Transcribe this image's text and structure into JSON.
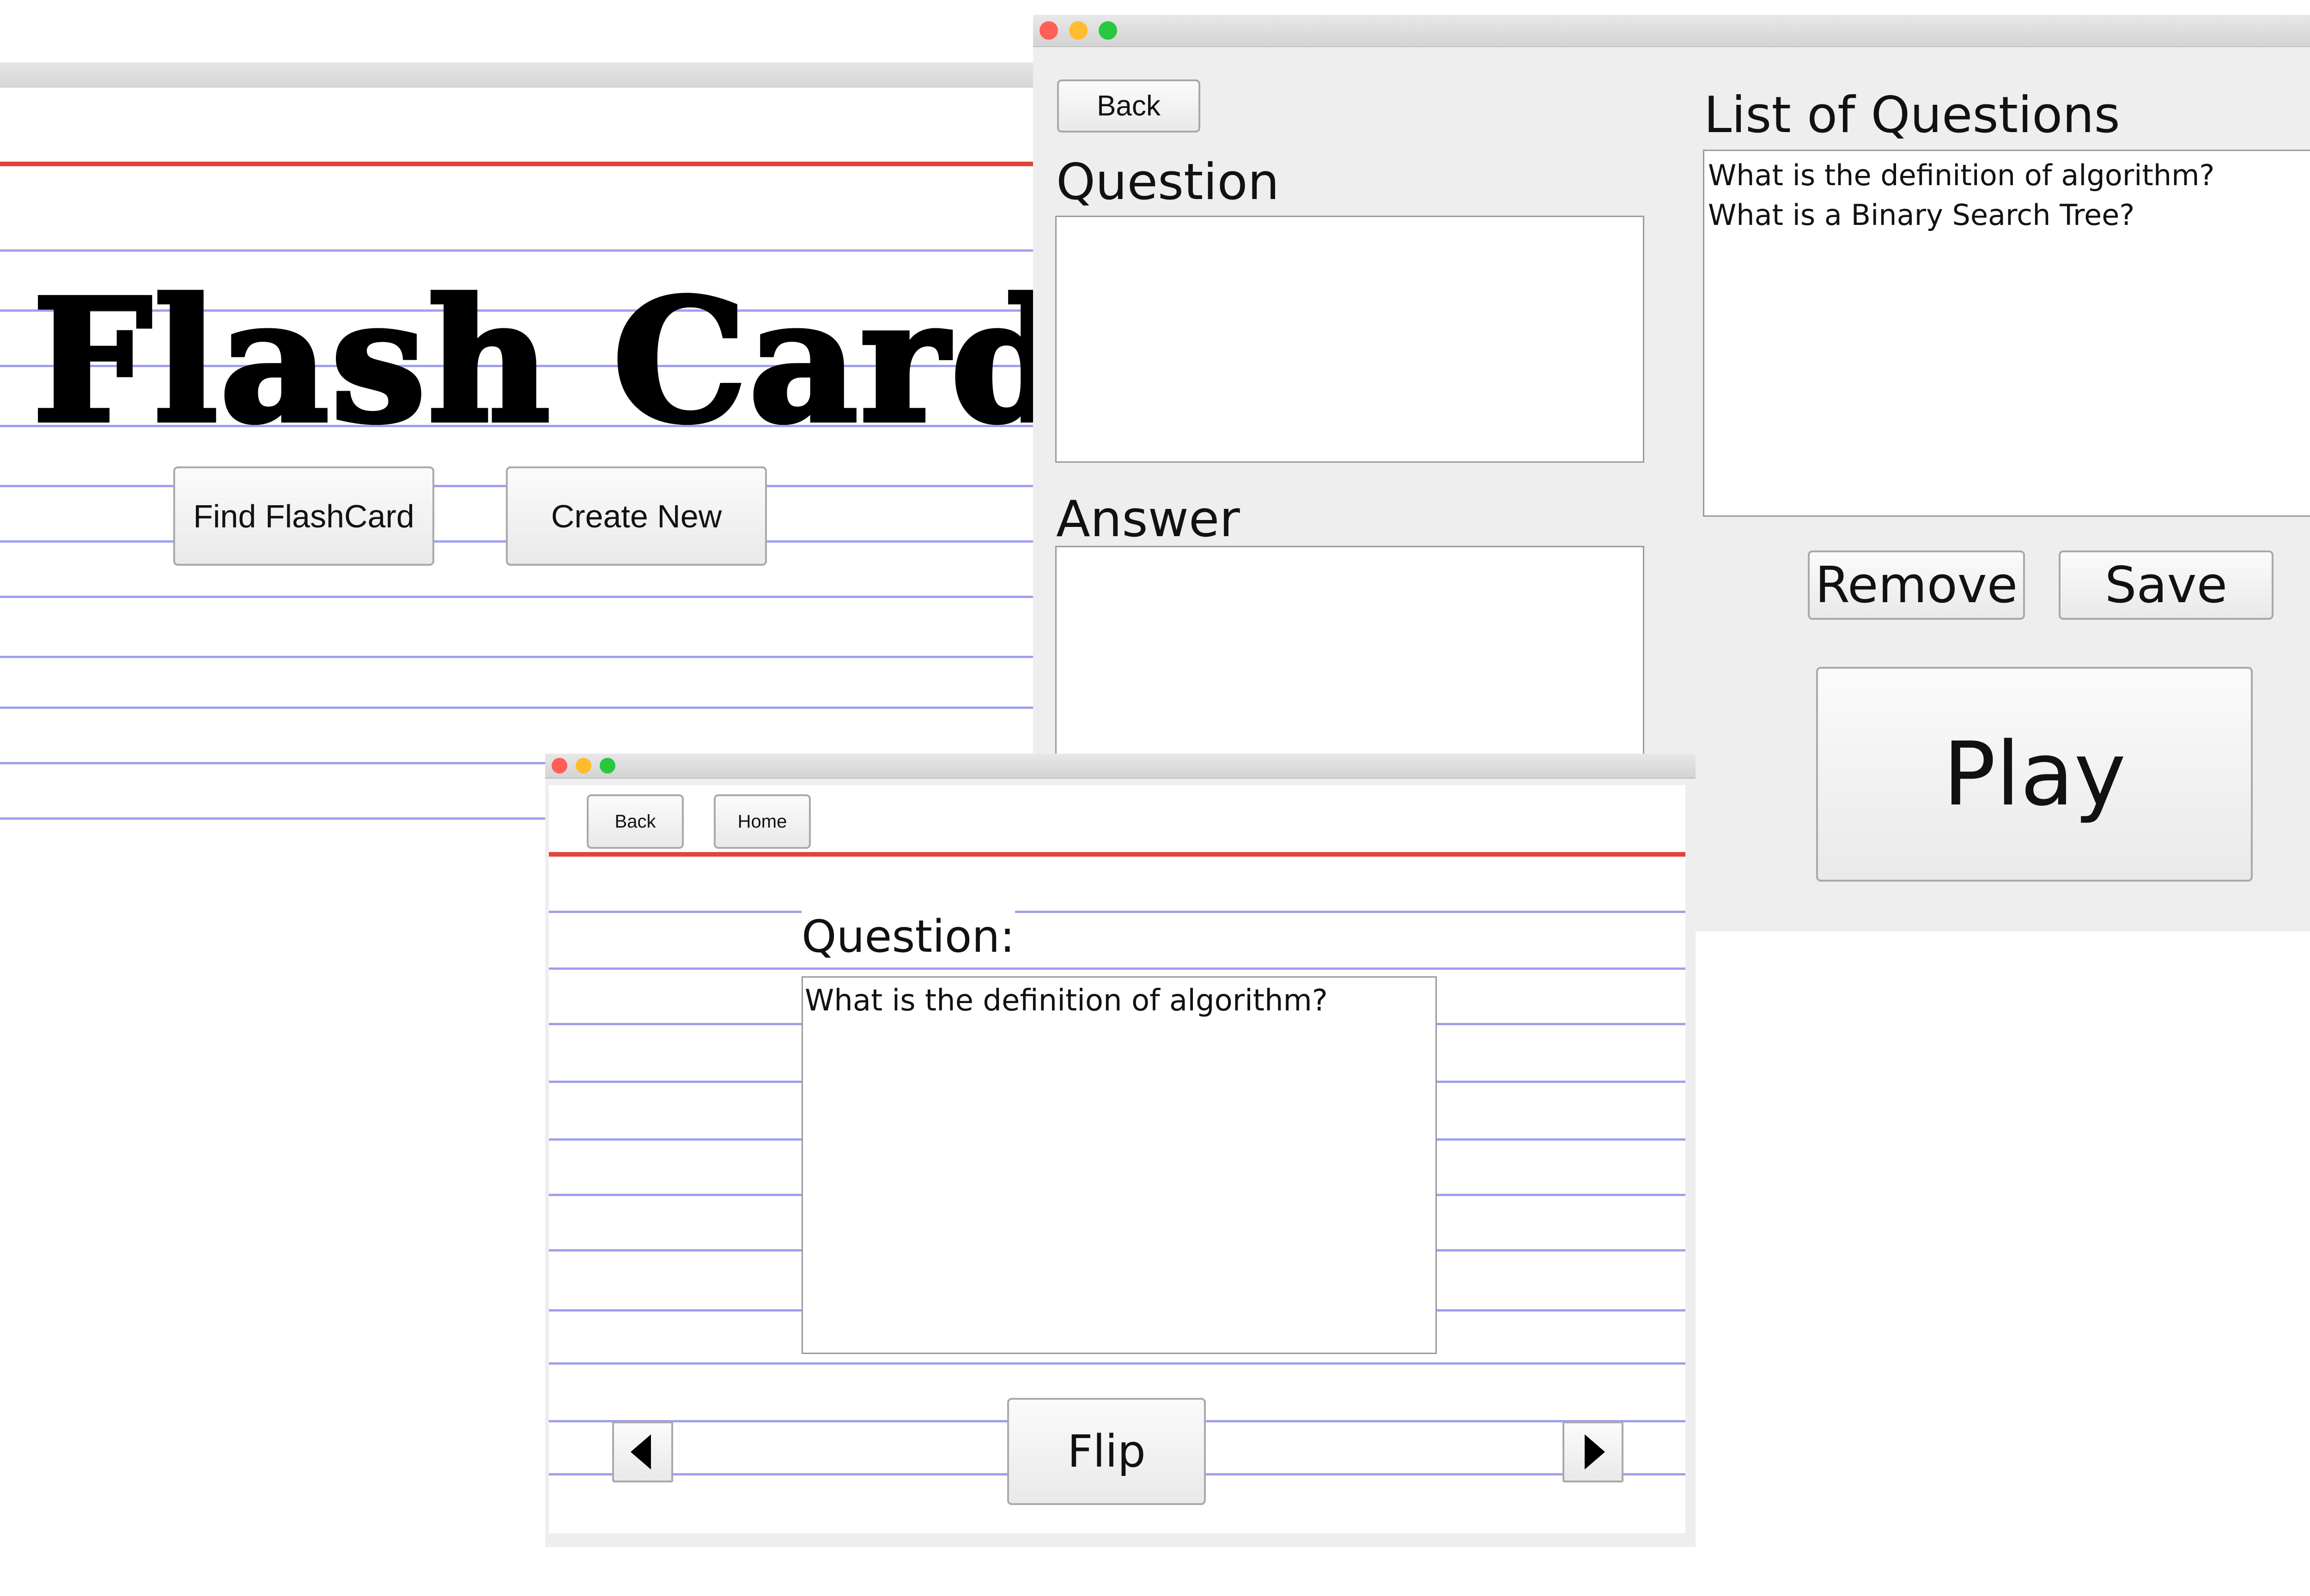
{
  "home_window": {
    "title": "Flash Card",
    "find_button": "Find FlashCard",
    "create_button": "Create New"
  },
  "editor_window": {
    "back_button": "Back",
    "question_label": "Question",
    "answer_label": "Answer",
    "list_label": "List of Questions",
    "questions": [
      "What is the definition of algorithm?",
      "What is a Binary Search Tree?"
    ],
    "remove_button": "Remove",
    "save_button": "Save",
    "play_button": "Play"
  },
  "play_window": {
    "back_button": "Back",
    "home_button": "Home",
    "question_label": "Question:",
    "question_text": "What is the definition of algorithm?",
    "flip_button": "Flip",
    "prev_icon": "left-arrow-icon",
    "next_icon": "right-arrow-icon"
  },
  "colors": {
    "red_margin_line": "#e0453b",
    "blue_ruled_line": "#9f9ff0",
    "window_bg": "#eeeeee",
    "close": "#ff5f57",
    "minimize": "#febc2e",
    "zoom": "#28c840"
  }
}
